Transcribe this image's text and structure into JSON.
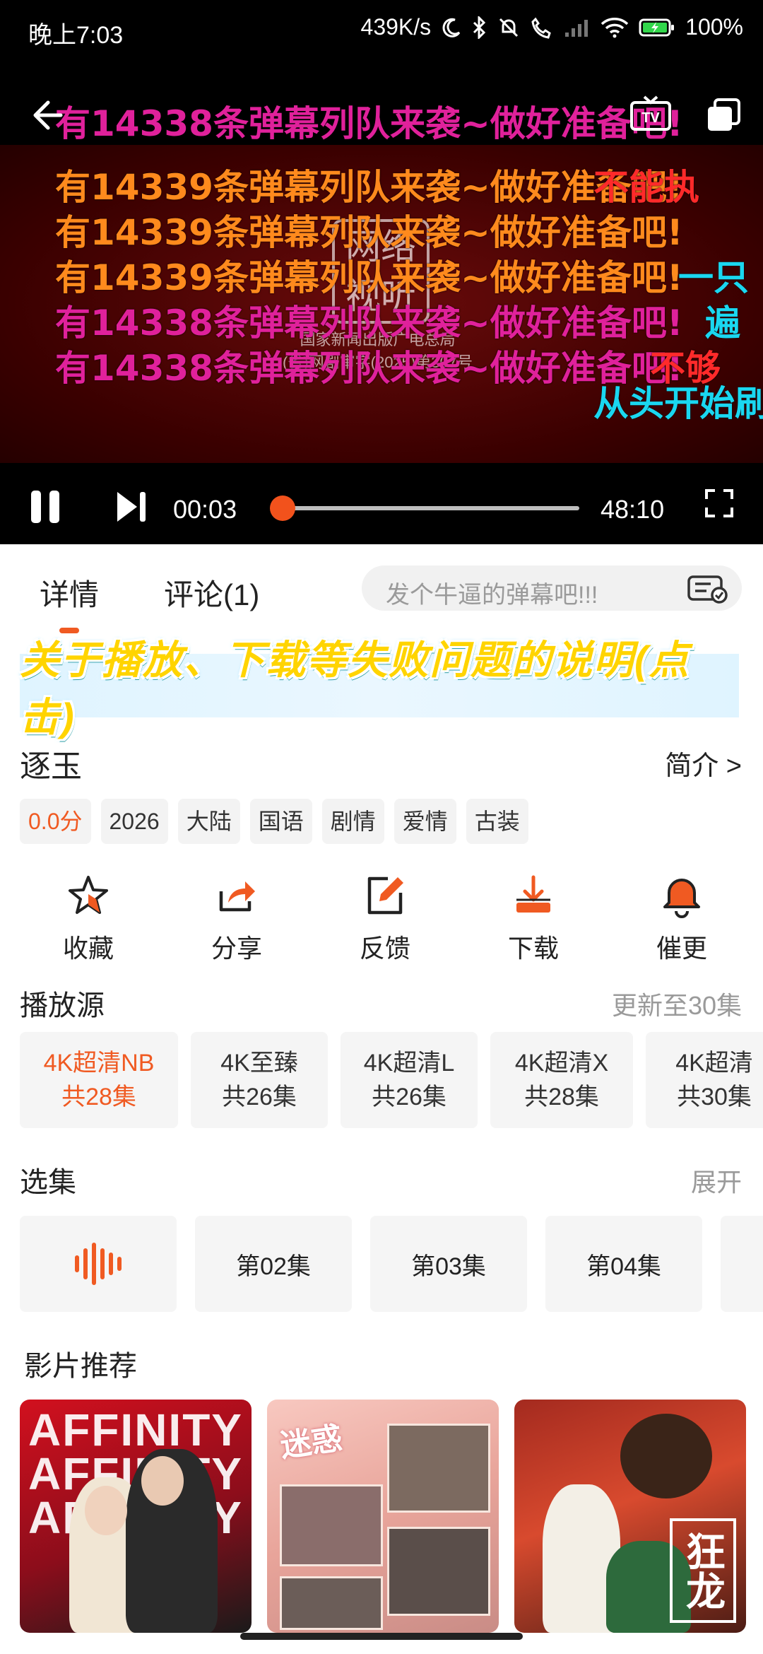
{
  "status_bar": {
    "time": "晚上7:03",
    "net_speed": "439K/s",
    "battery": "100%"
  },
  "player": {
    "current_time": "00:03",
    "total_time": "48:10",
    "progress": 0.001,
    "video_caption_line1": "国家新闻出版广电总局",
    "video_caption_line2": "(省)网剧审字(2025)第307号",
    "danmaku": [
      {
        "text": "有14338条弹幕列队来袭~做好准备吧!",
        "color": "#e0219b"
      },
      {
        "text": "有14339条弹幕列队来袭~做好准备吧!",
        "color": "#ff8a1d"
      },
      {
        "text": "有14339条弹幕列队来袭~做好准备吧!",
        "color": "#ff8a1d"
      },
      {
        "text": "有14339条弹幕列队来袭~做好准备吧!",
        "color": "#ff8a1d"
      },
      {
        "text": "有14338条弹幕列队来袭~做好准备吧!",
        "color": "#e0219b"
      },
      {
        "text": "有14338条弹幕列队来袭~做好准备吧!",
        "color": "#e0219b"
      },
      {
        "text": "从头开始刷",
        "color": "#1ad7f0"
      },
      {
        "text": "一只",
        "color": "#1ad7f0"
      },
      {
        "text": "遍",
        "color": "#1ad7f0"
      },
      {
        "text": "不能执",
        "color": "#ff2a2a"
      },
      {
        "text": "不够",
        "color": "#ff2a2a"
      }
    ]
  },
  "tabs": {
    "details": "详情",
    "comments": "评论(1)",
    "danmaku_placeholder": "发个牛逼的弹幕吧!!!"
  },
  "notice": {
    "part1": "关于播放、下载等失败问题的说明",
    "part2": "(点击)"
  },
  "show": {
    "title": "逐玉",
    "intro_link": "简介 >",
    "tags": [
      "0.0分",
      "2026",
      "大陆",
      "国语",
      "剧情",
      "爱情",
      "古装"
    ]
  },
  "actions": [
    {
      "label": "收藏",
      "icon": "star-icon"
    },
    {
      "label": "分享",
      "icon": "share-icon"
    },
    {
      "label": "反馈",
      "icon": "edit-icon"
    },
    {
      "label": "下载",
      "icon": "download-icon"
    },
    {
      "label": "催更",
      "icon": "bell-icon"
    }
  ],
  "sources": {
    "title": "播放源",
    "update_info": "更新至30集",
    "items": [
      {
        "name": "4K超清NB",
        "count": "共28集"
      },
      {
        "name": "4K至臻",
        "count": "共26集"
      },
      {
        "name": "4K超清L",
        "count": "共26集"
      },
      {
        "name": "4K超清X",
        "count": "共28集"
      },
      {
        "name": "4K超清",
        "count": "共30集"
      }
    ]
  },
  "episodes": {
    "title": "选集",
    "expand": "展开",
    "items": [
      "第02集",
      "第03集",
      "第04集"
    ]
  },
  "recommendations": {
    "title": "影片推荐",
    "items": [
      {
        "poster_text": "AFFINITY"
      },
      {
        "poster_text": "迷惑"
      },
      {
        "poster_text": "狂龙"
      }
    ]
  },
  "colors": {
    "accent": "#f05a22",
    "notice_blue": "#1c5fd6"
  }
}
